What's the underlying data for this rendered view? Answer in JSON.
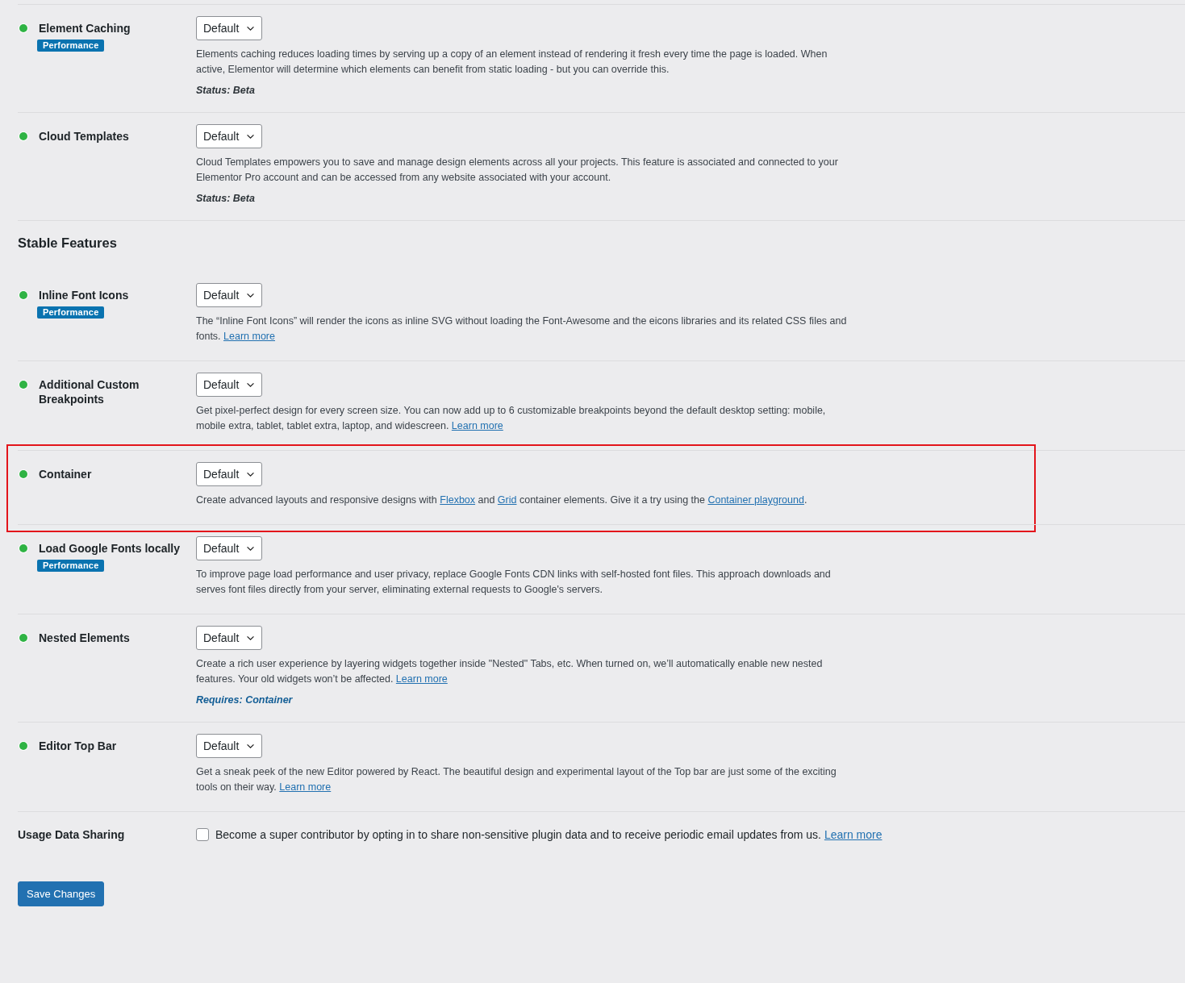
{
  "features_top": [
    {
      "name": "Element Caching",
      "badge": "Performance",
      "select": "Default",
      "highlighted": false,
      "description": [
        {
          "kind": "text",
          "text": "Elements caching reduces loading times by serving up a copy of an element instead of rendering it fresh every time the page is loaded. When active, Elementor will determine which elements can benefit from static loading - but you can override this."
        }
      ],
      "note": {
        "kind": "status",
        "text": "Status: Beta"
      }
    },
    {
      "name": "Cloud Templates",
      "select": "Default",
      "highlighted": false,
      "description": [
        {
          "kind": "text",
          "text": "Cloud Templates empowers you to save and manage design elements across all your projects. This feature is associated and connected to your Elementor Pro account and can be accessed from any website associated with your account."
        }
      ],
      "note": {
        "kind": "status",
        "text": "Status: Beta"
      }
    }
  ],
  "section_title": "Stable Features",
  "features_stable": [
    {
      "name": "Inline Font Icons",
      "badge": "Performance",
      "select": "Default",
      "highlighted": false,
      "description": [
        {
          "kind": "text",
          "text": "The “Inline Font Icons” will render the icons as inline SVG without loading the Font-Awesome and the eicons libraries and its related CSS files and fonts. "
        },
        {
          "kind": "link",
          "text": "Learn more"
        }
      ]
    },
    {
      "name": "Additional Custom Breakpoints",
      "select": "Default",
      "highlighted": false,
      "description": [
        {
          "kind": "text",
          "text": "Get pixel-perfect design for every screen size. You can now add up to 6 customizable breakpoints beyond the default desktop setting: mobile, mobile extra, tablet, tablet extra, laptop, and widescreen. "
        },
        {
          "kind": "link",
          "text": "Learn more"
        }
      ]
    },
    {
      "name": "Container",
      "select": "Default",
      "highlighted": true,
      "description": [
        {
          "kind": "text",
          "text": "Create advanced layouts and responsive designs with "
        },
        {
          "kind": "link",
          "text": "Flexbox"
        },
        {
          "kind": "text",
          "text": " and "
        },
        {
          "kind": "link",
          "text": "Grid"
        },
        {
          "kind": "text",
          "text": " container elements. Give it a try using the "
        },
        {
          "kind": "link",
          "text": "Container playground"
        },
        {
          "kind": "text",
          "text": "."
        }
      ]
    },
    {
      "name": "Load Google Fonts locally",
      "badge": "Performance",
      "select": "Default",
      "highlighted": false,
      "description": [
        {
          "kind": "text",
          "text": "To improve page load performance and user privacy, replace Google Fonts CDN links with self-hosted font files. This approach downloads and serves font files directly from your server, eliminating external requests to Google's servers."
        }
      ]
    },
    {
      "name": "Nested Elements",
      "select": "Default",
      "highlighted": false,
      "description": [
        {
          "kind": "text",
          "text": "Create a rich user experience by layering widgets together inside \"Nested\" Tabs, etc. When turned on, we’ll automatically enable new nested features. Your old widgets won’t be affected. "
        },
        {
          "kind": "link",
          "text": "Learn more"
        }
      ],
      "note": {
        "kind": "requires",
        "text": "Requires: Container"
      }
    },
    {
      "name": "Editor Top Bar",
      "select": "Default",
      "highlighted": false,
      "description": [
        {
          "kind": "text",
          "text": "Get a sneak peek of the new Editor powered by React. The beautiful design and experimental layout of the Top bar are just some of the exciting tools on their way. "
        },
        {
          "kind": "link",
          "text": "Learn more"
        }
      ]
    }
  ],
  "usage": {
    "label": "Usage Data Sharing",
    "checked": false,
    "text": "Become a super contributor by opting in to share non-sensitive plugin data and to receive periodic email updates from us. ",
    "link": "Learn more"
  },
  "save_button": "Save Changes"
}
